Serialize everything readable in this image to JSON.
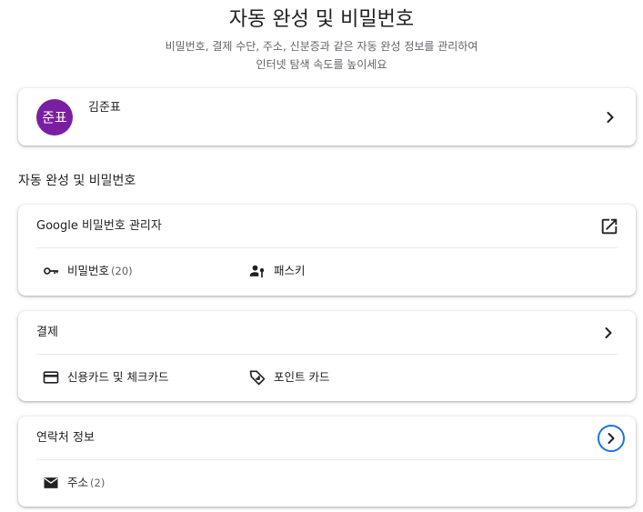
{
  "header": {
    "title": "자동 완성 및 비밀번호",
    "subtitle_line1": "비밀번호, 결제 수단, 주소, 신분증과 같은 자동 완성 정보를 관리하여",
    "subtitle_line2": "인터넷 탐색 속도를 높이세요"
  },
  "profile": {
    "avatar_text": "준표",
    "avatar_color": "#7b1fa2",
    "name": "김준표"
  },
  "section_title": "자동 완성 및 비밀번호",
  "password_manager": {
    "label": "Google 비밀번호 관리자",
    "items": [
      {
        "icon": "key-icon",
        "label": "비밀번호",
        "count": "(20)"
      },
      {
        "icon": "passkey-icon",
        "label": "패스키"
      }
    ]
  },
  "payment": {
    "label": "결제",
    "items": [
      {
        "icon": "credit-card-icon",
        "label": "신용카드 및 체크카드"
      },
      {
        "icon": "loyalty-tag-icon",
        "label": "포인트 카드"
      }
    ]
  },
  "contact": {
    "label": "연락처 정보",
    "items": [
      {
        "icon": "mail-icon",
        "label": "주소",
        "count": "(2)"
      }
    ]
  },
  "colors": {
    "accent": "#1a73e8",
    "text": "#202124",
    "secondary_text": "#5f6368"
  }
}
